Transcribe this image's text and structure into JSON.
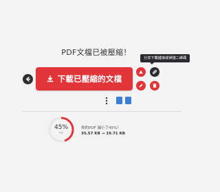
{
  "page": {
    "title": "PDF文檔已被壓縮！"
  },
  "actions": {
    "download_label": "下載已壓縮的文檔",
    "share_tooltip": "分享下載鏈接或掃描二維碼"
  },
  "result": {
    "percent_text": "45%",
    "gauge_sub": "PDF",
    "saved_text": "你的PDF 減小了45%！",
    "sizes_text": "35.57 KB → 19.71 KB",
    "reduction_fraction": 0.45
  },
  "colors": {
    "accent": "#e2353a",
    "dark": "#2b2b2f",
    "blue": "#3d7fd6",
    "background": "#f3f3f4"
  },
  "icons": {
    "back": "arrow-left-icon",
    "download": "download-icon",
    "drive": "upload-cloud-icon",
    "link": "link-icon",
    "delete": "trash-icon",
    "more": "more-vertical-icon"
  }
}
